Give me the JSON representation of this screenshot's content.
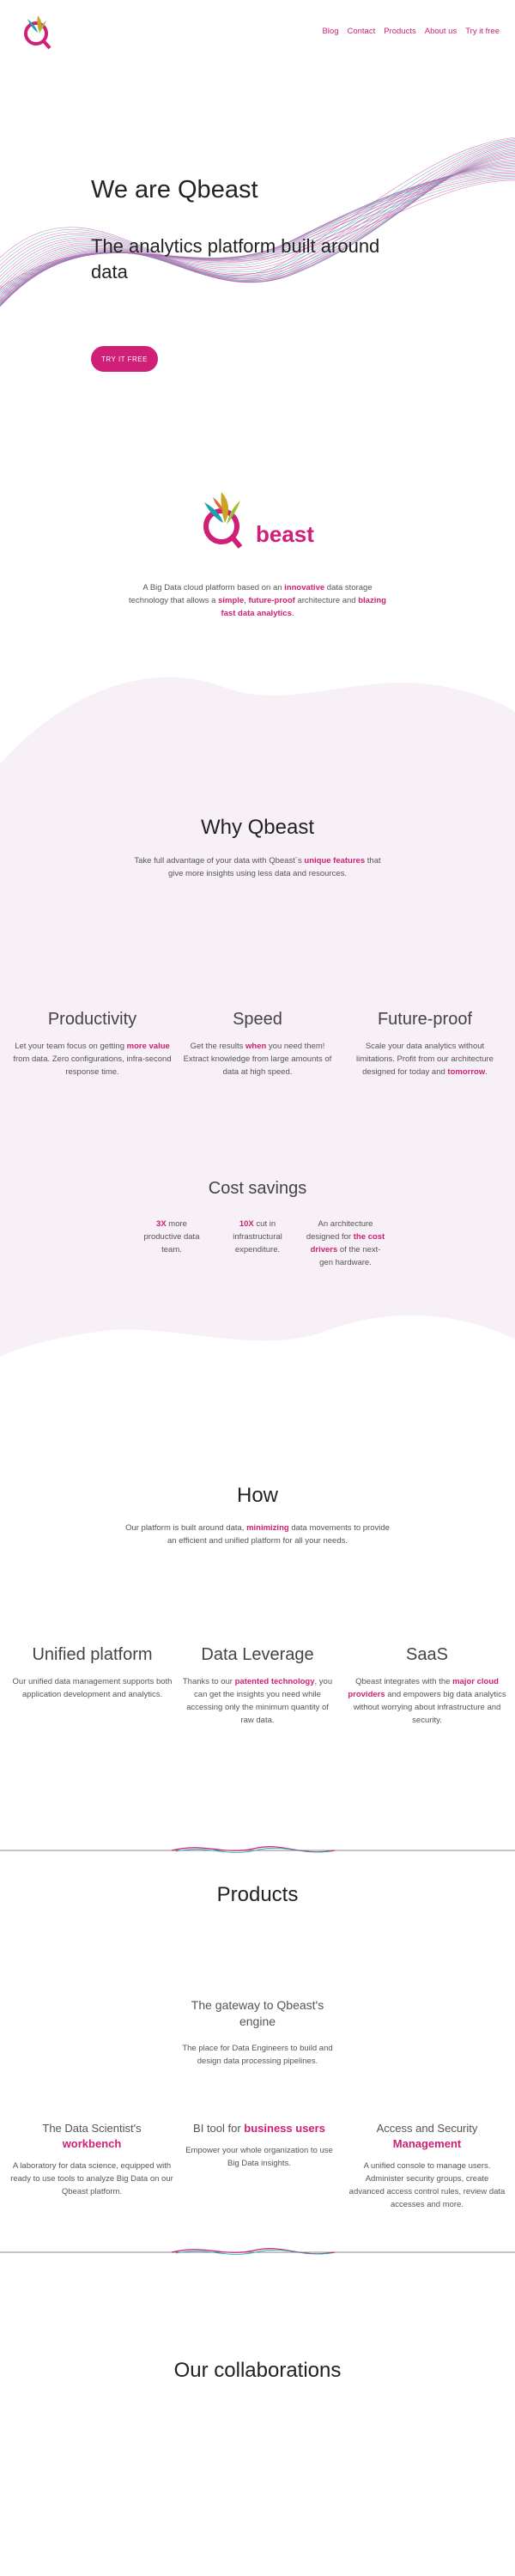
{
  "header": {
    "nav": [
      "Blog",
      "Contact",
      "Products",
      "About us",
      "Try it free"
    ]
  },
  "hero": {
    "title": "We are Qbeast",
    "subtitle": "The analytics platform built around data",
    "cta": "TRY IT FREE"
  },
  "about": {
    "logo_word": "beast",
    "text_parts": [
      "A Big Data cloud platform based on an ",
      "innovative",
      " data storage technology that allows a ",
      "simple",
      ", ",
      "future-proof",
      " architecture and ",
      "blazing fast data analytics",
      "."
    ]
  },
  "why": {
    "title": "Why Qbeast",
    "sub_parts": [
      "Take full advantage of your data with Qbeast´s ",
      "unique features",
      " that give more insights using less data and resources."
    ],
    "features": [
      {
        "title": "Productivity",
        "parts": [
          "Let your team focus on getting ",
          "more value",
          " from data. Zero configurations, infra-second response time."
        ]
      },
      {
        "title": "Speed",
        "parts": [
          "Get the results ",
          "when",
          " you need them! Extract knowledge from large amounts of data at high speed."
        ]
      },
      {
        "title": "Future-proof",
        "parts": [
          "Scale your data analytics without limitations. Profit from our architecture designed for today and ",
          "tomorrow",
          "."
        ]
      }
    ],
    "cost_title": "Cost savings",
    "cost_items": [
      {
        "parts": [
          "3X",
          " more productive data team."
        ]
      },
      {
        "parts": [
          "10X",
          " cut in infrastructural expenditure."
        ]
      },
      {
        "parts": [
          "An architecture designed for ",
          "the cost drivers",
          " of the next-gen hardware."
        ]
      }
    ]
  },
  "how": {
    "title": "How",
    "sub_parts": [
      "Our platform is built around data, ",
      "minimizing",
      " data movements to provide an efficient and unified platform for all your needs."
    ],
    "features": [
      {
        "title": "Unified platform",
        "parts": [
          "Our unified data management supports both application development and analytics."
        ]
      },
      {
        "title": "Data Leverage",
        "parts": [
          "Thanks to our ",
          "patented technology",
          ", you can get the insights you need while accessing only the minimum quantity of raw data."
        ]
      },
      {
        "title": "SaaS",
        "parts": [
          "Qbeast integrates with the ",
          "major cloud providers",
          " and empowers big data analytics without worrying about infrastructure and security."
        ]
      }
    ]
  },
  "products": {
    "title": "Products",
    "engine_title": "The gateway to Qbeast's engine",
    "engine_text": "The place for Data Engineers to build and design data processing pipelines.",
    "items": [
      {
        "title_parts": [
          "The Data Scientist's ",
          "workbench"
        ],
        "text": "A laboratory for data science, equipped with ready to use tools to analyze Big Data on our Qbeast platform."
      },
      {
        "title_parts": [
          "BI tool for ",
          "business users"
        ],
        "text": "Empower your whole organization to use Big Data insights."
      },
      {
        "title_parts": [
          "Access and Security ",
          "Management"
        ],
        "text": "A unified console to manage users. Administer security groups, create advanced access control rules, review data accesses and more."
      }
    ]
  },
  "collab": {
    "title": "Our collaborations"
  }
}
